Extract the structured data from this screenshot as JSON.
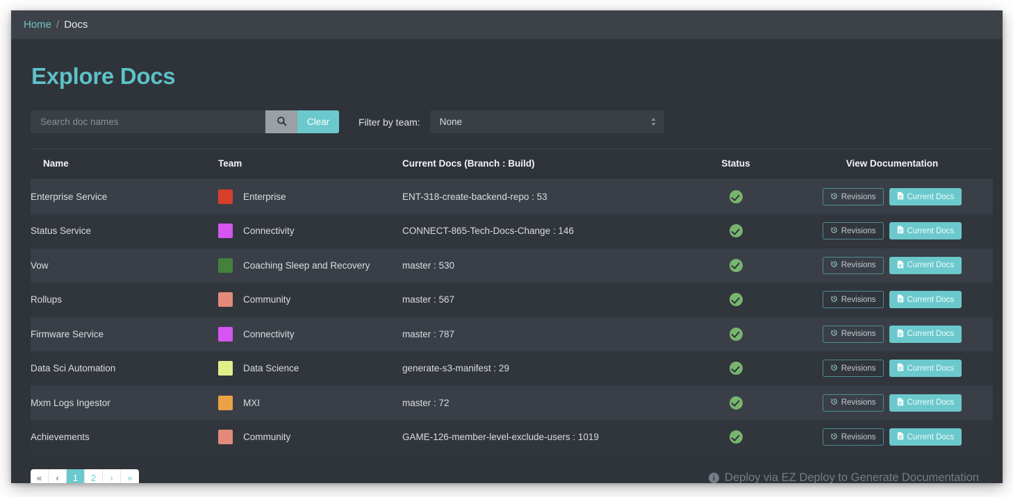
{
  "breadcrumb": {
    "home_label": "Home",
    "separator": "/",
    "current_label": "Docs"
  },
  "page": {
    "title": "Explore Docs"
  },
  "search": {
    "placeholder": "Search doc names",
    "value": "",
    "search_icon": "search-icon",
    "clear_label": "Clear"
  },
  "filter": {
    "label": "Filter by team:",
    "selected": "None",
    "options": [
      "None"
    ]
  },
  "table": {
    "headers": {
      "name": "Name",
      "team": "Team",
      "docs": "Current Docs (Branch : Build)",
      "status": "Status",
      "view": "View Documentation"
    },
    "row_buttons": {
      "revisions_label": "Revisions",
      "revisions_icon": "history-icon",
      "current_label": "Current Docs",
      "current_icon": "document-icon",
      "status_icon": "check-circle-icon"
    },
    "rows": [
      {
        "name": "Enterprise Service",
        "team": "Enterprise",
        "team_color": "#d6402a",
        "docs": "ENT-318-create-backend-repo : 53",
        "status": "ok"
      },
      {
        "name": "Status Service",
        "team": "Connectivity",
        "team_color": "#d455ef",
        "docs": "CONNECT-865-Tech-Docs-Change : 146",
        "status": "ok"
      },
      {
        "name": "Vow",
        "team": "Coaching Sleep and Recovery",
        "team_color": "#43813c",
        "docs": "master : 530",
        "status": "ok"
      },
      {
        "name": "Rollups",
        "team": "Community",
        "team_color": "#e48a7b",
        "docs": "master : 567",
        "status": "ok"
      },
      {
        "name": "Firmware Service",
        "team": "Connectivity",
        "team_color": "#d455ef",
        "docs": "master : 787",
        "status": "ok"
      },
      {
        "name": "Data Sci Automation",
        "team": "Data Science",
        "team_color": "#dff089",
        "docs": "generate-s3-manifest : 29",
        "status": "ok"
      },
      {
        "name": "Mxm Logs Ingestor",
        "team": "MXI",
        "team_color": "#eba245",
        "docs": "master : 72",
        "status": "ok"
      },
      {
        "name": "Achievements",
        "team": "Community",
        "team_color": "#e48a7b",
        "docs": "GAME-126-member-level-exclude-users : 1019",
        "status": "ok"
      }
    ]
  },
  "pagination": {
    "first_label": "«",
    "prev_label": "‹",
    "next_label": "›",
    "last_label": "»",
    "pages": [
      "1",
      "2"
    ],
    "active_page": "1"
  },
  "footer": {
    "info_icon": "info-icon",
    "info_glyph": "i",
    "note": "Deploy via EZ Deploy to Generate Documentation"
  },
  "colors": {
    "accent": "#6bc9cd",
    "title": "#5dc1c6",
    "panel": "#2f333a",
    "breadcrumb_bar": "#3d4249",
    "row_odd": "#3a3f47",
    "row_even": "#31353c",
    "status_green": "#78b56e"
  }
}
